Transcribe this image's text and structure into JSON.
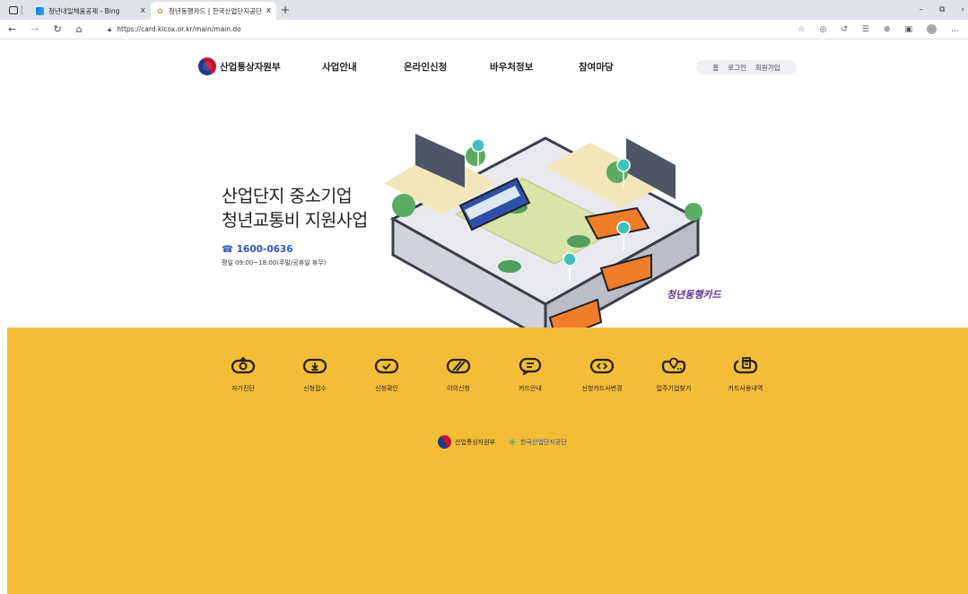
{
  "browser": {
    "tabs": [
      {
        "title": "청년내일채움공제 - Bing",
        "active": false
      },
      {
        "title": "청년동행카드 | 한국산업단지공단",
        "active": true
      }
    ],
    "new_tab": "+",
    "close": "x",
    "url": "https://card.kicox.or.kr/main/main.do",
    "window_controls": {
      "minimize": "–",
      "restore": "⧉",
      "more": "›"
    }
  },
  "header": {
    "logo_text": "산업통상자원부",
    "nav": [
      "사업안내",
      "온라인신청",
      "바우처정보",
      "참여마당"
    ],
    "util": [
      "홈",
      "로그인",
      "회원가입"
    ]
  },
  "hero": {
    "title_line1": "산업단지 중소기업",
    "title_line2": "청년교통비 지원사업",
    "tel": "☎ 1600-0636",
    "hours": "평일 09:00~18:00(주말/공휴일 휴무)",
    "brand": "청년동행카드"
  },
  "quick_menu": [
    {
      "label": "자가진단",
      "icon": "self-check-icon"
    },
    {
      "label": "신청접수",
      "icon": "download-icon"
    },
    {
      "label": "신청확인",
      "icon": "check-icon"
    },
    {
      "label": "이의신청",
      "icon": "slash-icon"
    },
    {
      "label": "카드안내",
      "icon": "chat-icon"
    },
    {
      "label": "신청카드사변경",
      "icon": "code-icon"
    },
    {
      "label": "입주기업찾기",
      "icon": "map-pin-icon"
    },
    {
      "label": "카드사용내역",
      "icon": "card-history-icon"
    }
  ],
  "footer": {
    "org1": "산업통상자원부",
    "org2": "한국산업단지공단"
  },
  "colors": {
    "accent_yellow": "#f4bd38",
    "tel_blue": "#2e57b8",
    "brand_purple": "#5a2f8c"
  }
}
